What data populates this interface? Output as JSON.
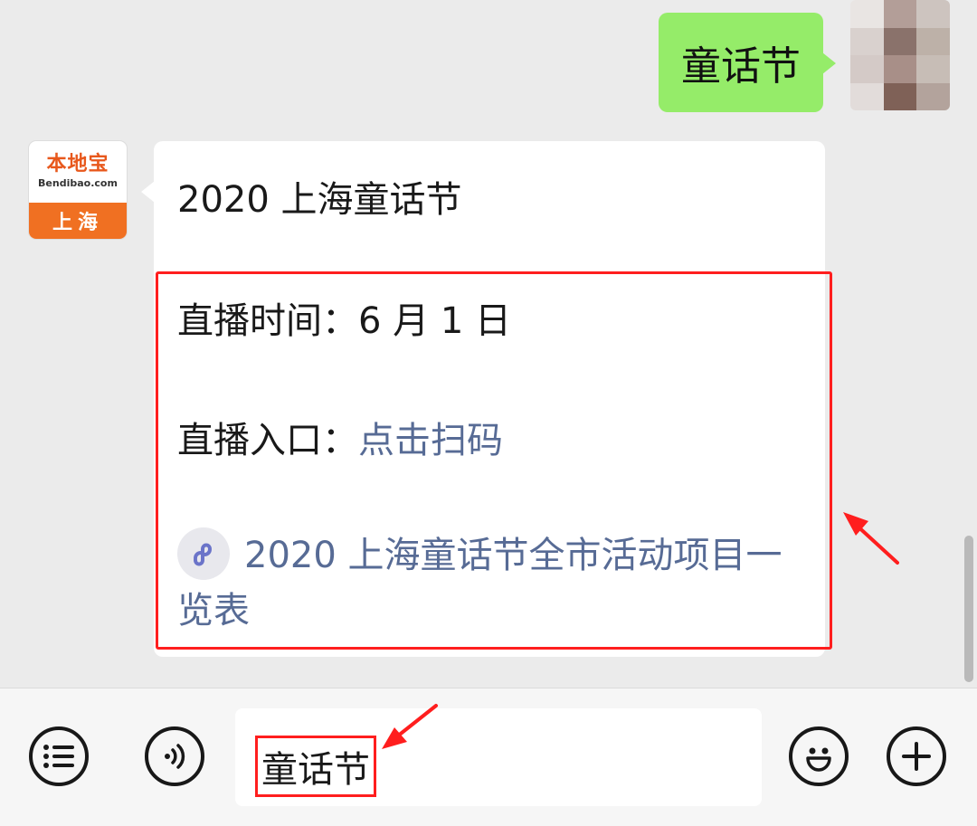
{
  "conversation": {
    "sent_message": "童话节",
    "bot": {
      "avatar_brand": "本地宝",
      "avatar_domain": "Bendibao.com",
      "avatar_city": "上海"
    },
    "reply": {
      "title": "2020 上海童话节",
      "time_label": "直播时间：",
      "time_value": "6 月 1 日",
      "entry_label": "直播入口：",
      "entry_link": "点击扫码",
      "mini_program_link": "2020 上海童话节全市活动项目一览表"
    }
  },
  "input_bar": {
    "input_value": "童话节",
    "menu_icon": "list-icon",
    "voice_icon": "voice-icon",
    "emoji_icon": "emoji-icon",
    "plus_icon": "plus-icon"
  },
  "colors": {
    "sent_bubble": "#95ec69",
    "link": "#576b95",
    "highlight": "#ff1e1e",
    "brand_orange": "#f07022"
  }
}
